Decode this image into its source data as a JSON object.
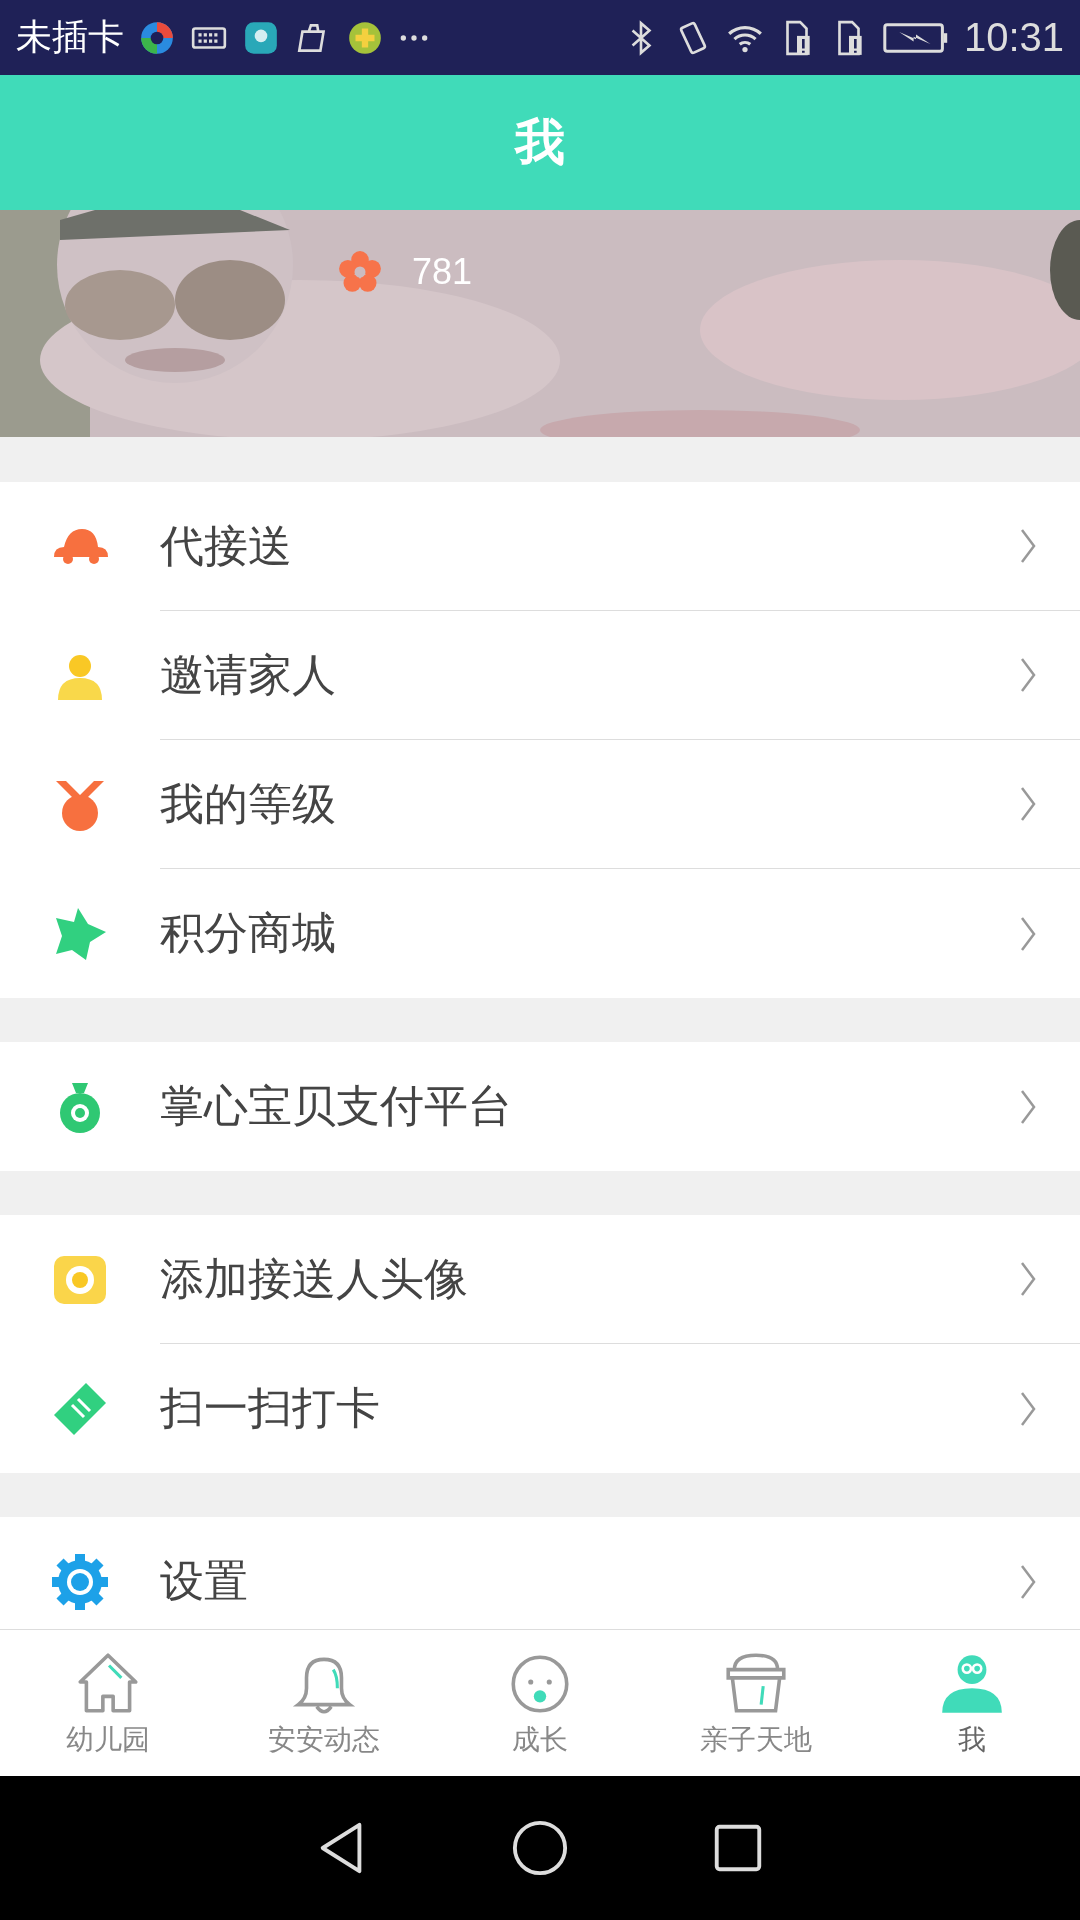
{
  "status_bar": {
    "carrier": "未插卡",
    "time": "10:31"
  },
  "header": {
    "title": "我"
  },
  "profile": {
    "kind": "picture",
    "points": "781"
  },
  "menu_groups": [
    {
      "items": [
        {
          "label": "代接送",
          "kind": "car"
        },
        {
          "label": "邀请家人",
          "kind": "person"
        },
        {
          "label": "我的等级",
          "kind": "medal"
        },
        {
          "label": "积分商城",
          "kind": "star"
        }
      ]
    },
    {
      "items": [
        {
          "label": "掌心宝贝支付平台",
          "kind": "moneybag"
        }
      ]
    },
    {
      "items": [
        {
          "label": "添加接送人头像",
          "kind": "camera"
        },
        {
          "label": "扫一扫打卡",
          "kind": "ticket"
        }
      ]
    },
    {
      "items": [
        {
          "label": "设置",
          "kind": "gear"
        }
      ]
    }
  ],
  "bottom_nav": [
    {
      "label": "幼儿园",
      "kind": "house",
      "selected": false
    },
    {
      "label": "安安动态",
      "kind": "bell",
      "selected": false
    },
    {
      "label": "成长",
      "kind": "baby",
      "selected": false
    },
    {
      "label": "亲子天地",
      "kind": "basket",
      "selected": false
    },
    {
      "label": "我",
      "kind": "user",
      "selected": true
    }
  ]
}
